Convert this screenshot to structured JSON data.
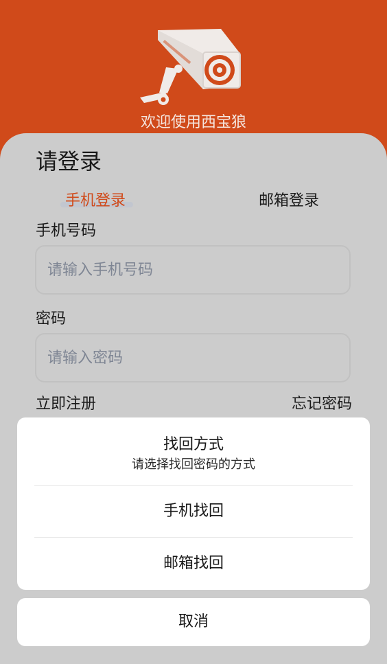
{
  "header": {
    "welcome": "欢迎使用西宝狼",
    "logo_icon": "security-camera-icon",
    "bg_color": "#d04a1a"
  },
  "login": {
    "title": "请登录",
    "tabs": [
      {
        "label": "手机登录",
        "active": true
      },
      {
        "label": "邮箱登录",
        "active": false
      }
    ],
    "phone_label": "手机号码",
    "phone_placeholder": "请输入手机号码",
    "password_label": "密码",
    "password_placeholder": "请输入密码",
    "register": "立即注册",
    "forgot": "忘记密码"
  },
  "sheet": {
    "title": "找回方式",
    "subtitle": "请选择找回密码的方式",
    "options": [
      "手机找回",
      "邮箱找回"
    ],
    "cancel": "取消"
  }
}
